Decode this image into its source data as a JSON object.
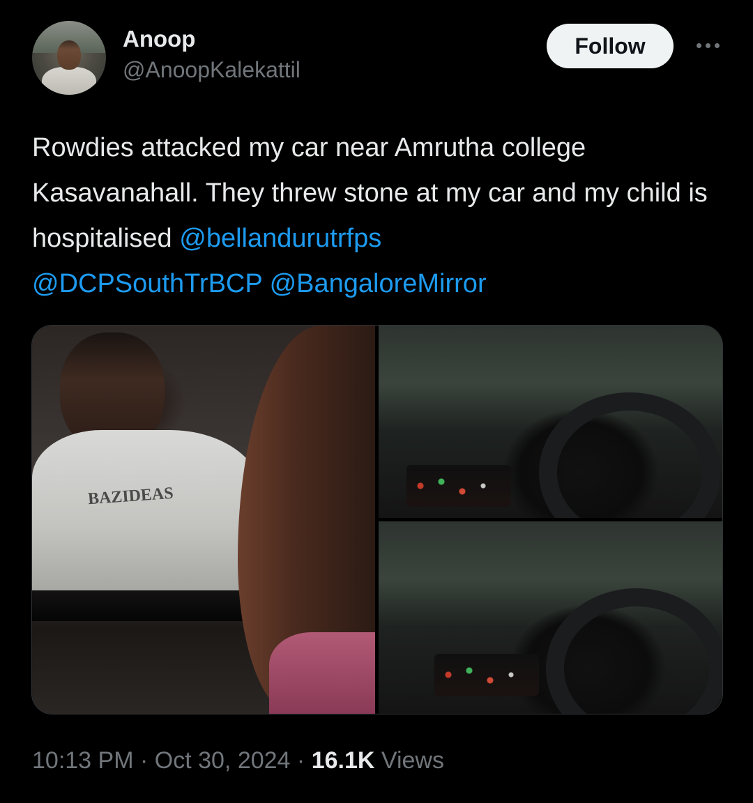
{
  "author": {
    "display_name": "Anoop",
    "handle": "@AnoopKalekattil",
    "avatar_icon": "user-avatar"
  },
  "actions": {
    "follow_label": "Follow",
    "more_icon": "more-horizontal-icon"
  },
  "tweet": {
    "text_before_mentions": "Rowdies attacked my car near Amrutha college Kasavanahall. They threw stone at my car and my child is hospitalised ",
    "mentions": [
      "@bellandurutrfps",
      "@DCPSouthTrBCP",
      "@BangaloreMirror"
    ]
  },
  "media": {
    "shirt_text": "BAZIDEAS"
  },
  "meta": {
    "time": "10:13 PM",
    "separator": "·",
    "date": "Oct 30, 2024",
    "views_count": "16.1K",
    "views_label": "Views"
  },
  "colors": {
    "background": "#000000",
    "text_primary": "#e7e9ea",
    "text_secondary": "#71767b",
    "link": "#1d9bf0",
    "follow_bg": "#eff3f4"
  }
}
